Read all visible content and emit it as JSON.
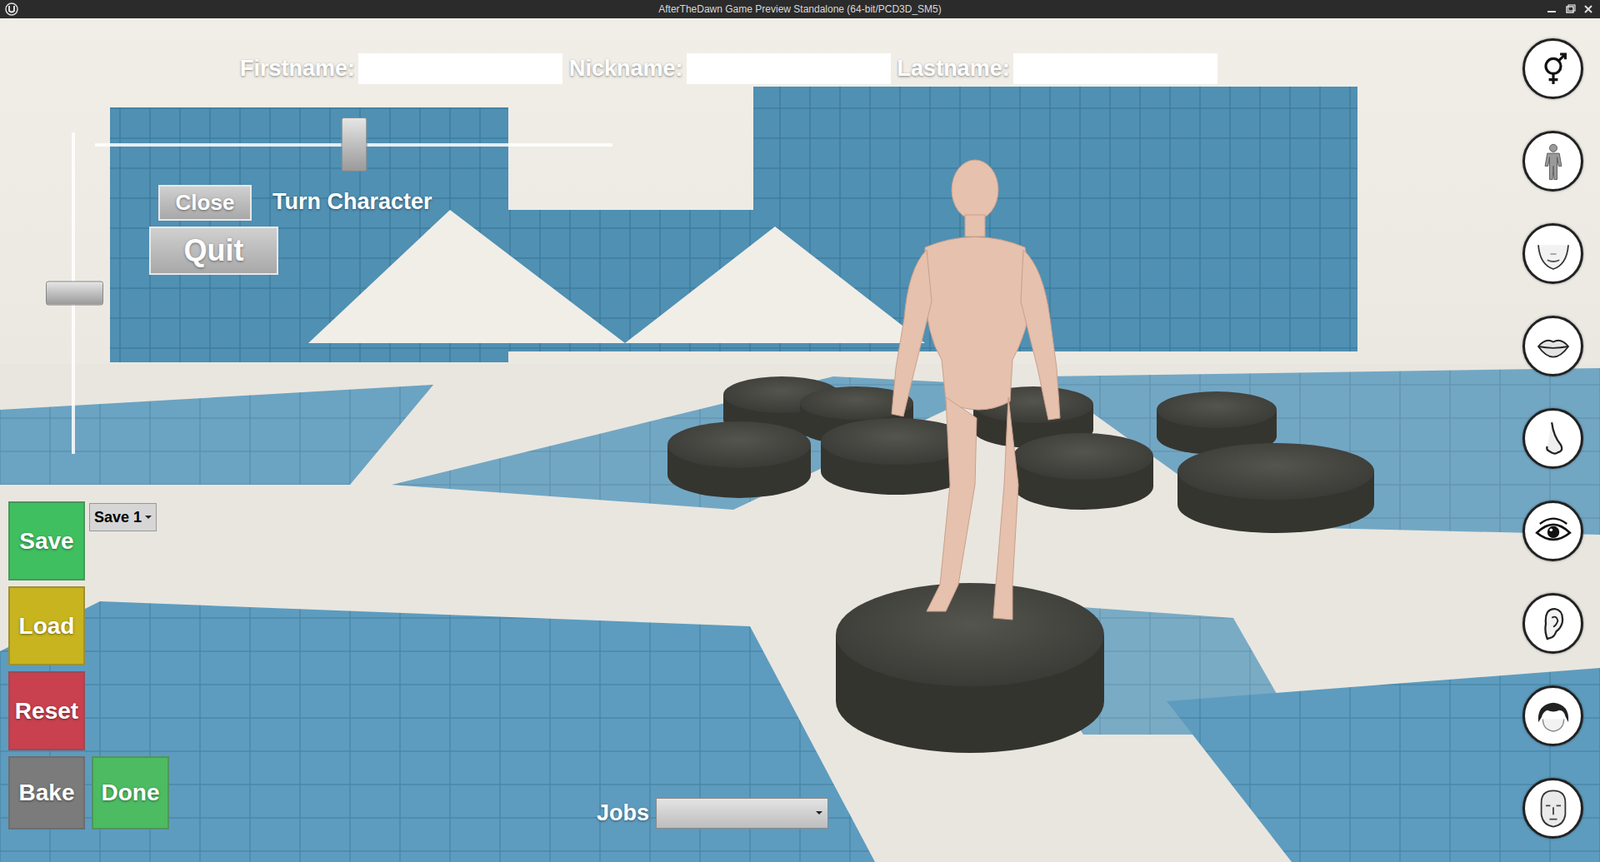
{
  "window": {
    "title": "AfterTheDawn Game Preview Standalone (64-bit/PCD3D_SM5)"
  },
  "name_fields": [
    {
      "label": "Firstname:",
      "value": ""
    },
    {
      "label": "Nickname:",
      "value": ""
    },
    {
      "label": "Lastname:",
      "value": ""
    }
  ],
  "turn_slider": {
    "label": "Turn Character",
    "level": 0.5
  },
  "vertical_slider": {
    "level": 0.5
  },
  "menu_buttons": [
    "Close",
    "Quit"
  ],
  "save_slot": {
    "value": "Save 1"
  },
  "action_buttons": [
    {
      "label": "Save",
      "color": "#3fbf60"
    },
    {
      "label": "Load",
      "color": "#c8b41e"
    },
    {
      "label": "Reset",
      "color": "#c9404f"
    },
    {
      "label": "Bake",
      "color": "#7b7b7b"
    },
    {
      "label": "Done",
      "color": "#4cbb62"
    }
  ],
  "jobs": {
    "label": "Jobs",
    "value": ""
  },
  "category_icons": [
    {
      "kind": "gender"
    },
    {
      "kind": "body"
    },
    {
      "kind": "jaw"
    },
    {
      "kind": "lips"
    },
    {
      "kind": "nose"
    },
    {
      "kind": "eye"
    },
    {
      "kind": "ear"
    },
    {
      "kind": "hair"
    },
    {
      "kind": "head"
    }
  ]
}
